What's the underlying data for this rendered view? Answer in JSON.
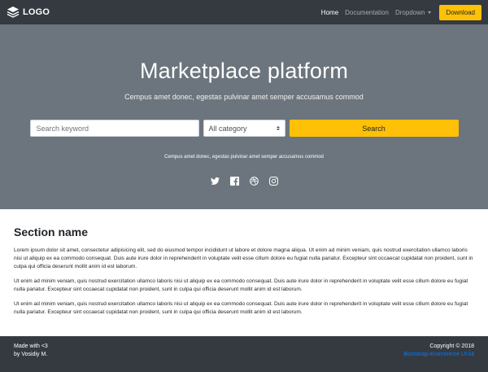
{
  "navbar": {
    "brand": "LOGO",
    "links": [
      {
        "label": "Home"
      },
      {
        "label": "Documentation"
      },
      {
        "label": "Dropdown"
      }
    ],
    "download_label": "Download"
  },
  "hero": {
    "title": "Marketplace platform",
    "subtitle": "Cempus amet donec, egestas pulvinar amet semper accusamus commod",
    "search_placeholder": "Search keyword",
    "category_selected": "All category",
    "search_button": "Search",
    "small_text": "Cempus amet donec, egestas pulvinar amet semper accusamus commod",
    "social_icons": [
      "twitter-icon",
      "facebook-icon",
      "dribbble-icon",
      "instagram-icon"
    ]
  },
  "section": {
    "title": "Section name",
    "paragraphs": [
      "Lorem ipsum dolor sit amet, consectetur adipisicing elit, sed do eiusmod tempor incididunt ut labore et dolore magna aliqua. Ut enim ad minim veniam, quis nostrud exercitation ullamco laboris nisi ut aliquip ex ea commodo consequat. Duis aute irure dolor in reprehenderit in voluptate velit esse cillum dolore eu fugiat nulla pariatur. Excepteur sint occaecat cupidatat non proident, sunt in culpa qui officia deserunt mollit anim id est laborum.",
      "Ut enim ad minim veniam, quis nostrud exercitation ullamco laboris nisi ut aliquip ex ea commodo consequat. Duis aute irure dolor in reprehenderit in voluptate velit esse cillum dolore eu fugiat nulla pariatur. Excepteur sint occaecat cupidatat non proident, sunt in culpa qui officia deserunt mollit anim id est laborum.",
      "Ut enim ad minim veniam, quis nostrud exercitation ullamco laboris nisi ut aliquip ex ea commodo consequat. Duis aute irure dolor in reprehenderit in voluptate velit esse cillum dolore eu fugiat nulla pariatur. Excepteur sint occaecat cupidatat non proident, sunt in culpa qui officia deserunt mollit anim id est laborum."
    ]
  },
  "footer": {
    "made_with": "Made with <3",
    "by": "by Vosidiy M.",
    "copyright": "Copyright © 2018",
    "link": "Bootstrap-ecommerce UI kit"
  },
  "colors": {
    "navbar_bg": "#343a40",
    "hero_bg": "#6c757d",
    "accent": "#ffc107",
    "link": "#007bff"
  }
}
